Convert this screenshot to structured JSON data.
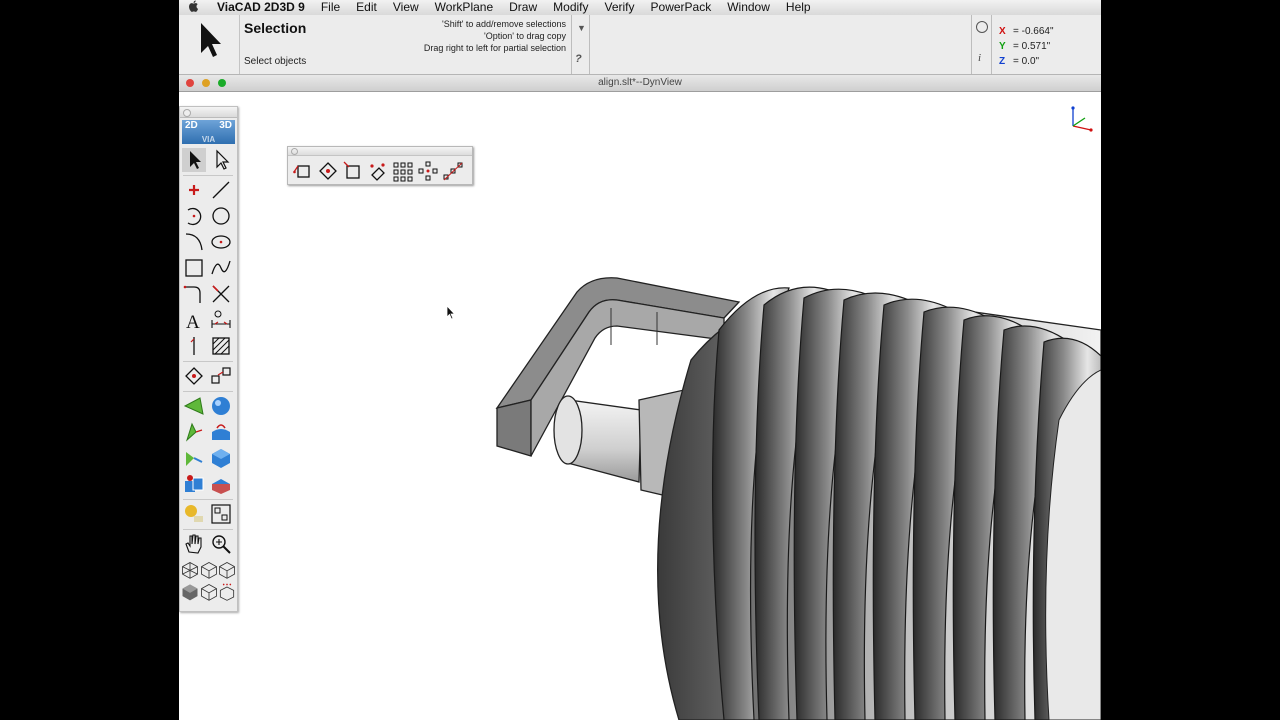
{
  "menubar": {
    "apple": "",
    "app": "ViaCAD 2D3D 9",
    "items": [
      "File",
      "Edit",
      "View",
      "WorkPlane",
      "Draw",
      "Modify",
      "Verify",
      "PowerPack",
      "Window",
      "Help"
    ]
  },
  "selection_bar": {
    "title": "Selection",
    "subtitle": "Select objects",
    "hints": [
      "'Shift' to add/remove selections",
      "'Option' to drag copy",
      "Drag right to left for partial selection"
    ],
    "help_glyph": "?",
    "options_glyph": "▼"
  },
  "coordinates": {
    "x_label": "X",
    "x_value": "= -0.664\"",
    "y_label": "Y",
    "y_value": "= 0.571\"",
    "z_label": "Z",
    "z_value": "= 0.0\"",
    "info_glyph": "i"
  },
  "window": {
    "title": "align.slt*--DynView"
  },
  "palette": {
    "logo_left": "2D",
    "logo_right": "3D",
    "logo_sub": "VIA"
  },
  "colors": {
    "x_color": "#d01010",
    "y_color": "#10a010",
    "z_color": "#1040d0",
    "tool_accent": "#c81a1a"
  }
}
